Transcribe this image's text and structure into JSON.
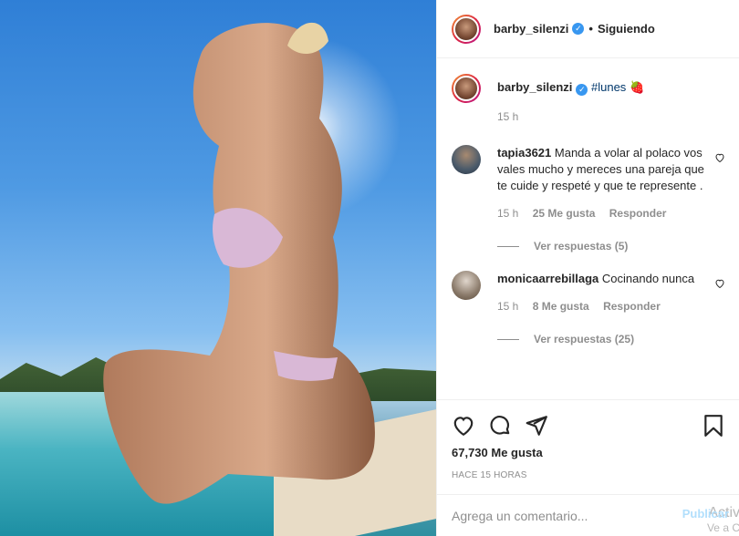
{
  "post": {
    "author": "barby_silenzi",
    "follow_dot": "•",
    "follow_label": "Siguiendo",
    "verified_glyph": "✓"
  },
  "caption": {
    "username": "barby_silenzi",
    "hashtag": "#lunes",
    "emoji": "🍓",
    "time": "15 h"
  },
  "comments": [
    {
      "username": "tapia3621",
      "text": "Manda a volar al polaco vos vales mucho y mereces una pareja que te cuide y respeté y que te represente .",
      "time": "15 h",
      "likes": "25 Me gusta",
      "reply": "Responder",
      "view_replies": "Ver respuestas (5)"
    },
    {
      "username": "monicaarrebillaga",
      "text": "Cocinando nunca",
      "time": "15 h",
      "likes": "8 Me gusta",
      "reply": "Responder",
      "view_replies": "Ver respuestas (25)"
    }
  ],
  "actions": {
    "likes": "67,730 Me gusta",
    "timestamp": "HACE 15 HORAS"
  },
  "add_comment": {
    "placeholder": "Agrega un comentario...",
    "publish": "Publicar"
  },
  "watermark": {
    "line1": "Activ",
    "line2": "Ve a C"
  },
  "icons": [
    "heart-icon",
    "comment-icon",
    "share-icon",
    "save-icon",
    "verified-icon"
  ],
  "colors": {
    "verified": "#3897f0",
    "publish": "#b2dffc",
    "muted": "#8e8e8e"
  }
}
